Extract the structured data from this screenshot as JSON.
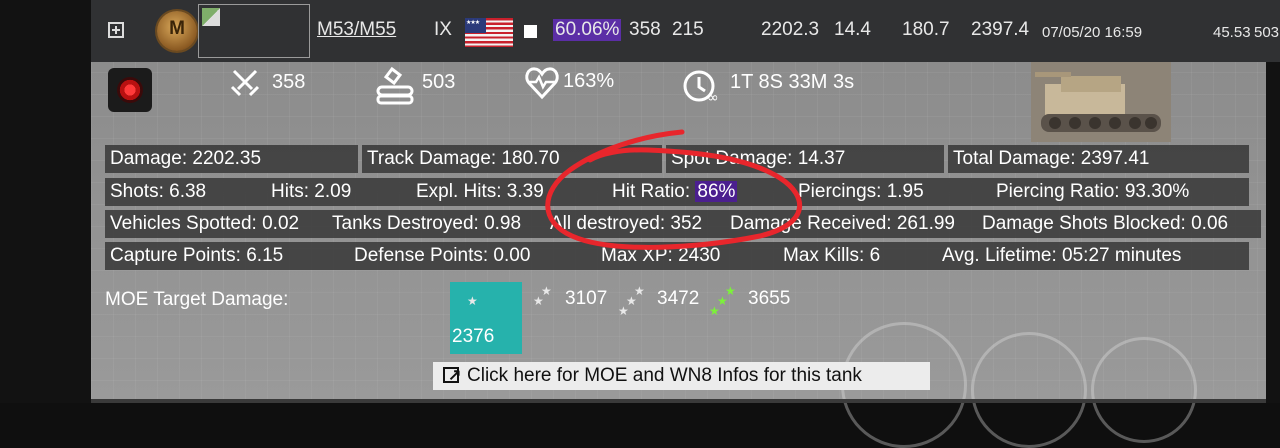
{
  "header": {
    "mastery_badge": "M",
    "tank_name": "M53/M55",
    "tier": "IX",
    "win_rate": "60.06%",
    "battles": "358",
    "wins": "215",
    "avg_damage": "2202.3",
    "avg_spot": "14.4",
    "avg_track": "180.7",
    "avg_total": "2397.4",
    "last_played": "07/05/20 16:59",
    "wn8_small": "45.53",
    "extra": "503",
    "nation_flag": "usa-flag"
  },
  "summary": {
    "battles": "358",
    "frags_or_kills": "503",
    "wn8_percent": "163%",
    "playtime": "1T 8S 33M 3s",
    "icons": [
      "crossed-swords-icon",
      "artillery-icon",
      "heartbeat-icon",
      "playtime-icon"
    ]
  },
  "stats": {
    "damage": "Damage: 2202.35",
    "track_damage": "Track Damage: 180.70",
    "spot_damage": "Spot Damage: 14.37",
    "total_damage": "Total Damage: 2397.41",
    "shots": "Shots: 6.38",
    "hits": "Hits: 2.09",
    "expl_hits": "Expl. Hits: 3.39",
    "hit_ratio_label": "Hit Ratio:",
    "hit_ratio_value": "86%",
    "piercings": "Piercings: 1.95",
    "piercing_ratio": "Piercing Ratio: 93.30%",
    "vehicles_spotted": "Vehicles Spotted: 0.02",
    "tanks_destroyed": "Tanks Destroyed: 0.98",
    "all_destroyed": "All destroyed: 352",
    "damage_received": "Damage Received: 261.99",
    "damage_blocked": "Damage Shots Blocked: 0.06",
    "capture_points": "Capture Points: 6.15",
    "defense_points": "Defense Points: 0.00",
    "max_xp": "Max XP: 2430",
    "max_kills": "Max Kills: 6",
    "avg_lifetime": "Avg. Lifetime: 05:27 minutes"
  },
  "moe": {
    "label": "MOE Target Damage:",
    "current": "2376",
    "one_mark": "3107",
    "two_marks": "3472",
    "three_marks": "3655"
  },
  "link_text": "Click here for MOE and WN8 Infos for this tank",
  "colors": {
    "header_bg": "#303133",
    "highlight_purple": "#5b2ea6",
    "moe_teal": "#26b2ac",
    "annotation_red": "#e8262c"
  }
}
